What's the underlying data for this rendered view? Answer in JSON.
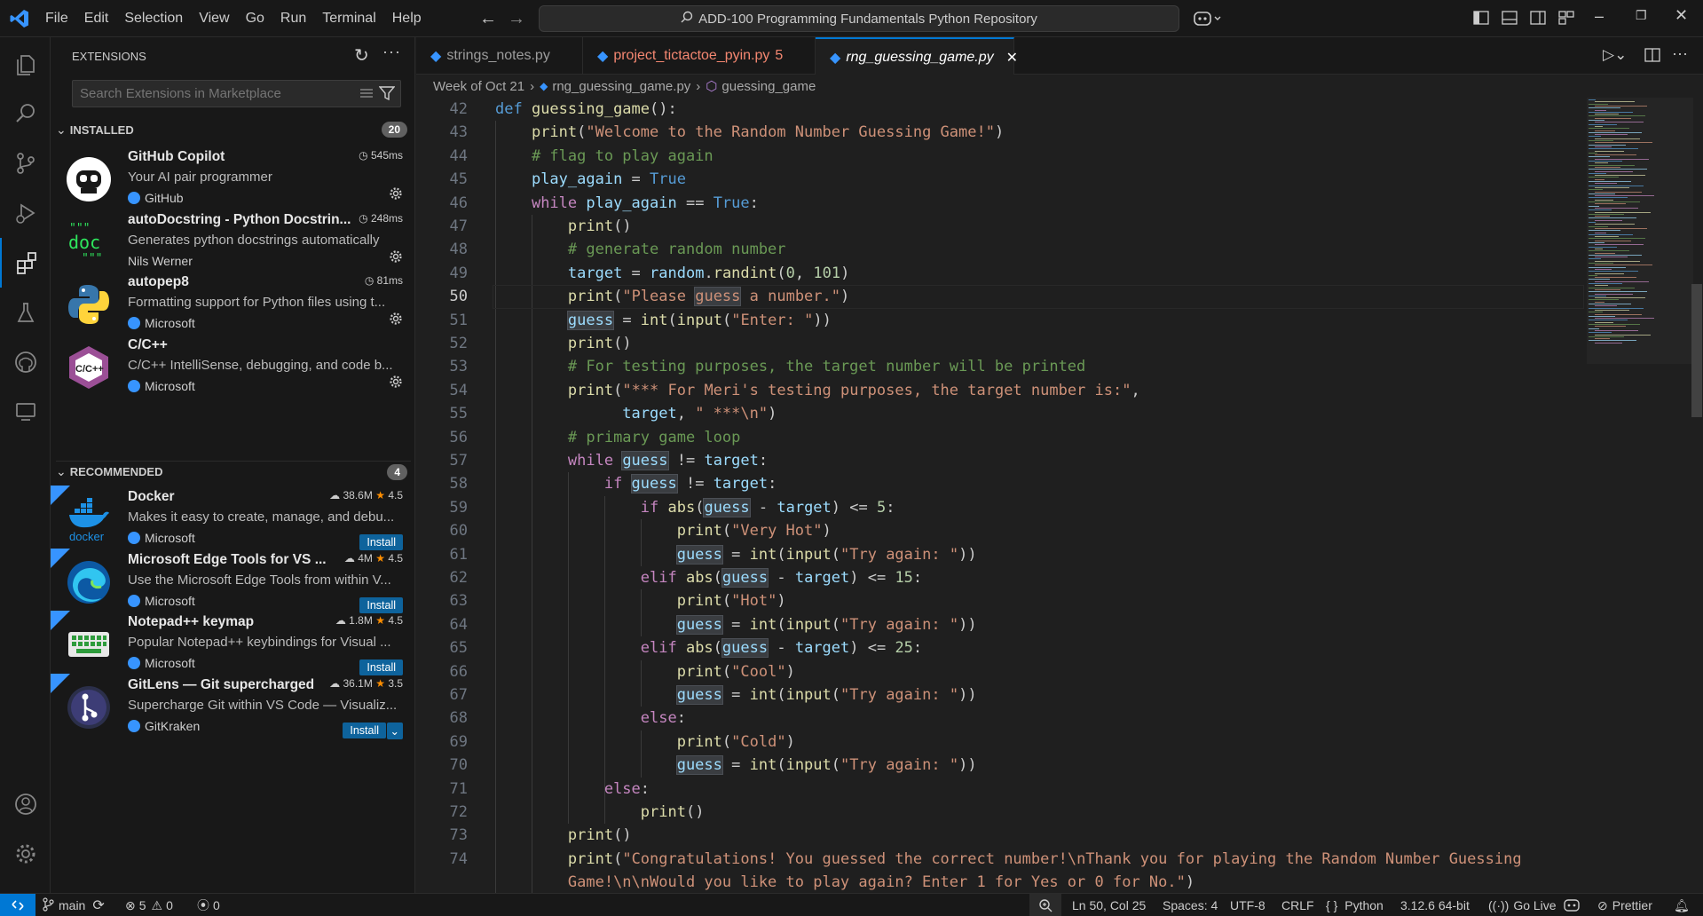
{
  "menu": [
    "File",
    "Edit",
    "Selection",
    "View",
    "Go",
    "Run",
    "Terminal",
    "Help"
  ],
  "command_center": "ADD-100 Programming Fundamentals Python Repository",
  "sidebar": {
    "title": "EXTENSIONS",
    "search_placeholder": "Search Extensions in Marketplace",
    "installed_label": "INSTALLED",
    "installed_count": "20",
    "recommended_label": "RECOMMENDED",
    "recommended_count": "4",
    "installed": [
      {
        "name": "GitHub Copilot",
        "desc": "Your AI pair programmer",
        "publisher": "GitHub",
        "meta": "545ms",
        "icon": "copilot-icon"
      },
      {
        "name": "autoDocstring - Python Docstrin...",
        "desc": "Generates python docstrings automatically",
        "publisher": "Nils Werner",
        "meta": "248ms",
        "icon": "doc-icon"
      },
      {
        "name": "autopep8",
        "desc": "Formatting support for Python files using t...",
        "publisher": "Microsoft",
        "meta": "81ms",
        "icon": "python-icon"
      },
      {
        "name": "C/C++",
        "desc": "C/C++ IntelliSense, debugging, and code b...",
        "publisher": "Microsoft",
        "meta": "",
        "icon": "cpp-icon"
      }
    ],
    "recommended": [
      {
        "name": "Docker",
        "desc": "Makes it easy to create, manage, and debu...",
        "publisher": "Microsoft",
        "downloads": "38.6M",
        "rating": "4.5",
        "install": "Install",
        "icon": "docker-icon"
      },
      {
        "name": "Microsoft Edge Tools for VS ...",
        "desc": "Use the Microsoft Edge Tools from within V...",
        "publisher": "Microsoft",
        "downloads": "4M",
        "rating": "4.5",
        "install": "Install",
        "icon": "edge-icon"
      },
      {
        "name": "Notepad++ keymap",
        "desc": "Popular Notepad++ keybindings for Visual ...",
        "publisher": "Microsoft",
        "downloads": "1.8M",
        "rating": "4.5",
        "install": "Install",
        "icon": "keyboard-icon"
      },
      {
        "name": "GitLens — Git supercharged",
        "desc": "Supercharge Git within VS Code — Visualiz...",
        "publisher": "GitKraken",
        "downloads": "36.1M",
        "rating": "3.5",
        "install": "Install",
        "icon": "gitlens-icon"
      }
    ]
  },
  "tabs": [
    {
      "label": "strings_notes.py",
      "badge": ""
    },
    {
      "label": "project_tictactoe_pyin.py",
      "badge": "5"
    },
    {
      "label": "rng_guessing_game.py",
      "badge": ""
    }
  ],
  "breadcrumb": [
    "Week of Oct 21",
    "rng_guessing_game.py",
    "guessing_game"
  ],
  "code": [
    {
      "n": "42",
      "t": [
        [
          "kb",
          "def "
        ],
        [
          "fn",
          "guessing_game"
        ],
        [
          "",
          "():"
        ]
      ]
    },
    {
      "n": "43",
      "t": [
        [
          "",
          "    "
        ],
        [
          "fn",
          "print"
        ],
        [
          "",
          "("
        ],
        [
          "st",
          "\"Welcome to the Random Number Guessing Game!\""
        ],
        [
          "",
          ")"
        ]
      ]
    },
    {
      "n": "44",
      "t": [
        [
          "",
          "    "
        ],
        [
          "cm",
          "# flag to play again"
        ]
      ]
    },
    {
      "n": "45",
      "t": [
        [
          "",
          "    "
        ],
        [
          "vr",
          "play_again"
        ],
        [
          "",
          " = "
        ],
        [
          "kb",
          "True"
        ]
      ]
    },
    {
      "n": "46",
      "t": [
        [
          "",
          "    "
        ],
        [
          "kw",
          "while "
        ],
        [
          "vr",
          "play_again"
        ],
        [
          "",
          " == "
        ],
        [
          "kb",
          "True"
        ],
        [
          "",
          ":"
        ]
      ]
    },
    {
      "n": "47",
      "t": [
        [
          "",
          "        "
        ],
        [
          "fn",
          "print"
        ],
        [
          "",
          "()"
        ]
      ]
    },
    {
      "n": "48",
      "t": [
        [
          "",
          "        "
        ],
        [
          "cm",
          "# generate random number"
        ]
      ]
    },
    {
      "n": "49",
      "t": [
        [
          "",
          "        "
        ],
        [
          "vr",
          "target"
        ],
        [
          "",
          " = "
        ],
        [
          "vr",
          "random"
        ],
        [
          "",
          "."
        ],
        [
          "fn",
          "randint"
        ],
        [
          "",
          "("
        ],
        [
          "nm2",
          "0"
        ],
        [
          "",
          ", "
        ],
        [
          "nm2",
          "101"
        ],
        [
          "",
          ")"
        ]
      ]
    },
    {
      "n": "50",
      "t": [
        [
          "",
          "        "
        ],
        [
          "fn",
          "print"
        ],
        [
          "",
          "("
        ],
        [
          "st",
          "\"Please "
        ],
        [
          "sth",
          "guess"
        ],
        [
          "st",
          " a number.\""
        ],
        [
          "",
          ")"
        ]
      ]
    },
    {
      "n": "51",
      "t": [
        [
          "",
          "        "
        ],
        [
          "vrh",
          "guess"
        ],
        [
          "",
          " = "
        ],
        [
          "fn",
          "int"
        ],
        [
          "",
          "("
        ],
        [
          "fn",
          "input"
        ],
        [
          "",
          "("
        ],
        [
          "st",
          "\"Enter: \""
        ],
        [
          "",
          "))"
        ]
      ]
    },
    {
      "n": "52",
      "t": [
        [
          "",
          "        "
        ],
        [
          "fn",
          "print"
        ],
        [
          "",
          "()"
        ]
      ]
    },
    {
      "n": "53",
      "t": [
        [
          "",
          "        "
        ],
        [
          "cm",
          "# For testing purposes, the target number will be printed"
        ]
      ]
    },
    {
      "n": "54",
      "t": [
        [
          "",
          "        "
        ],
        [
          "fn",
          "print"
        ],
        [
          "",
          "("
        ],
        [
          "st",
          "\"*** For Meri's testing purposes, the target number is:\""
        ],
        [
          "",
          ","
        ]
      ]
    },
    {
      "n": "55",
      "t": [
        [
          "",
          "              "
        ],
        [
          "vr",
          "target"
        ],
        [
          "",
          ", "
        ],
        [
          "st",
          "\" ***\\n\""
        ],
        [
          "",
          ")"
        ]
      ]
    },
    {
      "n": "56",
      "t": [
        [
          "",
          "        "
        ],
        [
          "cm",
          "# primary game loop"
        ]
      ]
    },
    {
      "n": "57",
      "t": [
        [
          "",
          "        "
        ],
        [
          "kw",
          "while "
        ],
        [
          "vrh",
          "guess"
        ],
        [
          "",
          " != "
        ],
        [
          "vr",
          "target"
        ],
        [
          "",
          ":"
        ]
      ]
    },
    {
      "n": "58",
      "t": [
        [
          "",
          "            "
        ],
        [
          "kw",
          "if "
        ],
        [
          "vrh",
          "guess"
        ],
        [
          "",
          " != "
        ],
        [
          "vr",
          "target"
        ],
        [
          "",
          ":"
        ]
      ]
    },
    {
      "n": "59",
      "t": [
        [
          "",
          "                "
        ],
        [
          "kw",
          "if "
        ],
        [
          "fn",
          "abs"
        ],
        [
          "",
          "("
        ],
        [
          "vrh",
          "guess"
        ],
        [
          "",
          " - "
        ],
        [
          "vr",
          "target"
        ],
        [
          "",
          ") <= "
        ],
        [
          "nm2",
          "5"
        ],
        [
          "",
          ":"
        ]
      ]
    },
    {
      "n": "60",
      "t": [
        [
          "",
          "                    "
        ],
        [
          "fn",
          "print"
        ],
        [
          "",
          "("
        ],
        [
          "st",
          "\"Very Hot\""
        ],
        [
          "",
          ")"
        ]
      ]
    },
    {
      "n": "61",
      "t": [
        [
          "",
          "                    "
        ],
        [
          "vrh",
          "guess"
        ],
        [
          "",
          " = "
        ],
        [
          "fn",
          "int"
        ],
        [
          "",
          "("
        ],
        [
          "fn",
          "input"
        ],
        [
          "",
          "("
        ],
        [
          "st",
          "\"Try again: \""
        ],
        [
          "",
          "))"
        ]
      ]
    },
    {
      "n": "62",
      "t": [
        [
          "",
          "                "
        ],
        [
          "kw",
          "elif "
        ],
        [
          "fn",
          "abs"
        ],
        [
          "",
          "("
        ],
        [
          "vrh",
          "guess"
        ],
        [
          "",
          " - "
        ],
        [
          "vr",
          "target"
        ],
        [
          "",
          ") <= "
        ],
        [
          "nm2",
          "15"
        ],
        [
          "",
          ":"
        ]
      ]
    },
    {
      "n": "63",
      "t": [
        [
          "",
          "                    "
        ],
        [
          "fn",
          "print"
        ],
        [
          "",
          "("
        ],
        [
          "st",
          "\"Hot\""
        ],
        [
          "",
          ")"
        ]
      ]
    },
    {
      "n": "64",
      "t": [
        [
          "",
          "                    "
        ],
        [
          "vrh",
          "guess"
        ],
        [
          "",
          " = "
        ],
        [
          "fn",
          "int"
        ],
        [
          "",
          "("
        ],
        [
          "fn",
          "input"
        ],
        [
          "",
          "("
        ],
        [
          "st",
          "\"Try again: \""
        ],
        [
          "",
          "))"
        ]
      ]
    },
    {
      "n": "65",
      "t": [
        [
          "",
          "                "
        ],
        [
          "kw",
          "elif "
        ],
        [
          "fn",
          "abs"
        ],
        [
          "",
          "("
        ],
        [
          "vrh",
          "guess"
        ],
        [
          "",
          " - "
        ],
        [
          "vr",
          "target"
        ],
        [
          "",
          ") <= "
        ],
        [
          "nm2",
          "25"
        ],
        [
          "",
          ":"
        ]
      ]
    },
    {
      "n": "66",
      "t": [
        [
          "",
          "                    "
        ],
        [
          "fn",
          "print"
        ],
        [
          "",
          "("
        ],
        [
          "st",
          "\"Cool\""
        ],
        [
          "",
          ")"
        ]
      ]
    },
    {
      "n": "67",
      "t": [
        [
          "",
          "                    "
        ],
        [
          "vrh",
          "guess"
        ],
        [
          "",
          " = "
        ],
        [
          "fn",
          "int"
        ],
        [
          "",
          "("
        ],
        [
          "fn",
          "input"
        ],
        [
          "",
          "("
        ],
        [
          "st",
          "\"Try again: \""
        ],
        [
          "",
          "))"
        ]
      ]
    },
    {
      "n": "68",
      "t": [
        [
          "",
          "                "
        ],
        [
          "kw",
          "else"
        ],
        [
          "",
          ":"
        ]
      ]
    },
    {
      "n": "69",
      "t": [
        [
          "",
          "                    "
        ],
        [
          "fn",
          "print"
        ],
        [
          "",
          "("
        ],
        [
          "st",
          "\"Cold\""
        ],
        [
          "",
          ")"
        ]
      ]
    },
    {
      "n": "70",
      "t": [
        [
          "",
          "                    "
        ],
        [
          "vrh",
          "guess"
        ],
        [
          "",
          " = "
        ],
        [
          "fn",
          "int"
        ],
        [
          "",
          "("
        ],
        [
          "fn",
          "input"
        ],
        [
          "",
          "("
        ],
        [
          "st",
          "\"Try again: \""
        ],
        [
          "",
          "))"
        ]
      ]
    },
    {
      "n": "71",
      "t": [
        [
          "",
          "            "
        ],
        [
          "kw",
          "else"
        ],
        [
          "",
          ":"
        ]
      ]
    },
    {
      "n": "72",
      "t": [
        [
          "",
          "                "
        ],
        [
          "fn",
          "print"
        ],
        [
          "",
          "()"
        ]
      ]
    },
    {
      "n": "73",
      "t": [
        [
          "",
          "        "
        ],
        [
          "fn",
          "print"
        ],
        [
          "",
          "()"
        ]
      ]
    },
    {
      "n": "74",
      "t": [
        [
          "",
          "        "
        ],
        [
          "fn",
          "print"
        ],
        [
          "",
          "("
        ],
        [
          "st",
          "\"Congratulations! You guessed the correct number!\\nThank you for playing the Random Number Guessing"
        ]
      ]
    },
    {
      "n": "",
      "t": [
        [
          "",
          "        "
        ],
        [
          "st",
          "Game!\\n\\nWould you like to play again? Enter 1 for Yes or 0 for No.\""
        ],
        [
          "",
          ")"
        ]
      ]
    }
  ],
  "current_line": "50",
  "status": {
    "branch": "main",
    "errors": "5",
    "warnings": "0",
    "ports": "0",
    "cursor": "Ln 50, Col 25",
    "spaces": "Spaces: 4",
    "encoding": "UTF-8",
    "eol": "CRLF",
    "language": "Python",
    "interpreter": "3.12.6 64-bit",
    "golive": "Go Live",
    "prettier": "Prettier"
  },
  "colors": {
    "accent": "#0078d4",
    "tab_modified": "#f48771",
    "install": "#0e639c"
  }
}
